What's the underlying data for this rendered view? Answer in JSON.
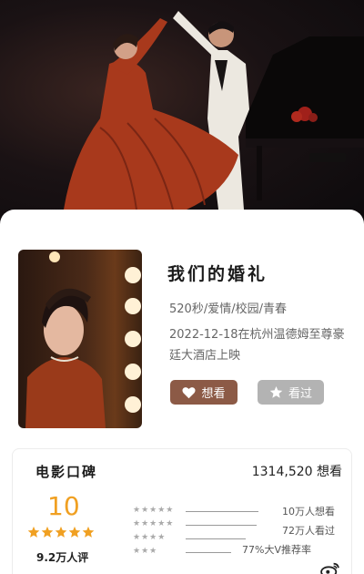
{
  "movie": {
    "title": "我们的婚礼",
    "meta": "520秒/爱情/校园/青春",
    "release": "2022-12-18在杭州温德姆至尊豪廷大酒店上映"
  },
  "actions": {
    "want_label": "想看",
    "seen_label": "看过"
  },
  "rating": {
    "section_title": "电影口碑",
    "want_count": "1314,520 想看",
    "score": "10",
    "stars": 5,
    "review_count": "9.2万人评",
    "distribution": [
      {
        "level": 5,
        "label": "10万人想看"
      },
      {
        "level": 4,
        "label": "72万人看过"
      },
      {
        "level": 3,
        "label": "77%大V推荐率"
      },
      {
        "level": 2,
        "label": ""
      }
    ]
  },
  "colors": {
    "accent_star": "#f0a022",
    "want_button": "#8c5a46",
    "seen_button": "#b3b3b3"
  },
  "icons": [
    "heart-icon",
    "star-icon",
    "weibo-icon"
  ]
}
